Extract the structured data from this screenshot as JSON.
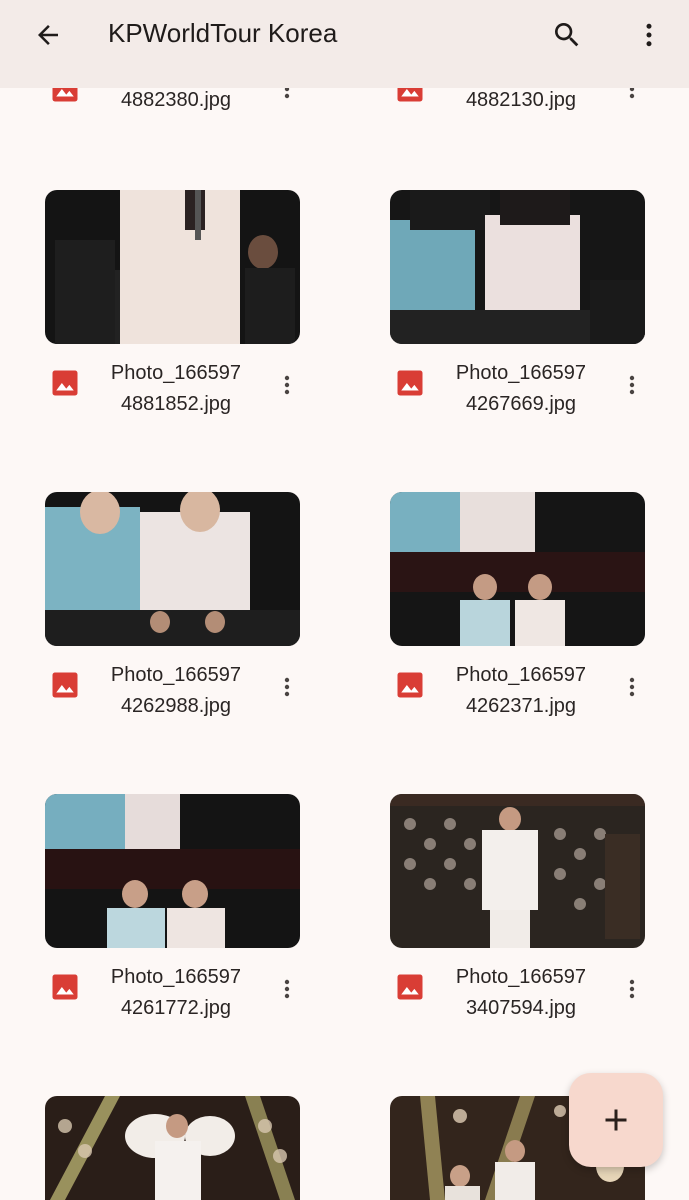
{
  "app_bar": {
    "title": "KPWorldTour Korea",
    "back_icon": "arrow-back-icon",
    "search_icon": "search-icon",
    "more_icon": "more-vert-icon",
    "background": "#f3ebe8"
  },
  "files": [
    {
      "line1": "",
      "line2": "4882380.jpg"
    },
    {
      "line1": "",
      "line2": "4882130.jpg"
    },
    {
      "line1": "Photo_166597",
      "line2": "4881852.jpg"
    },
    {
      "line1": "Photo_166597",
      "line2": "4267669.jpg"
    },
    {
      "line1": "Photo_166597",
      "line2": "4262988.jpg"
    },
    {
      "line1": "Photo_166597",
      "line2": "4262371.jpg"
    },
    {
      "line1": "Photo_166597",
      "line2": "4261772.jpg"
    },
    {
      "line1": "Photo_166597",
      "line2": "3407594.jpg"
    }
  ],
  "file_type_icon": "image-file-icon",
  "file_icon_color": "#d93d35",
  "item_menu_icon": "more-vert-icon",
  "fab": {
    "icon": "plus-icon",
    "color": "#f7d8cd"
  },
  "page_background": "#fdf8f6"
}
